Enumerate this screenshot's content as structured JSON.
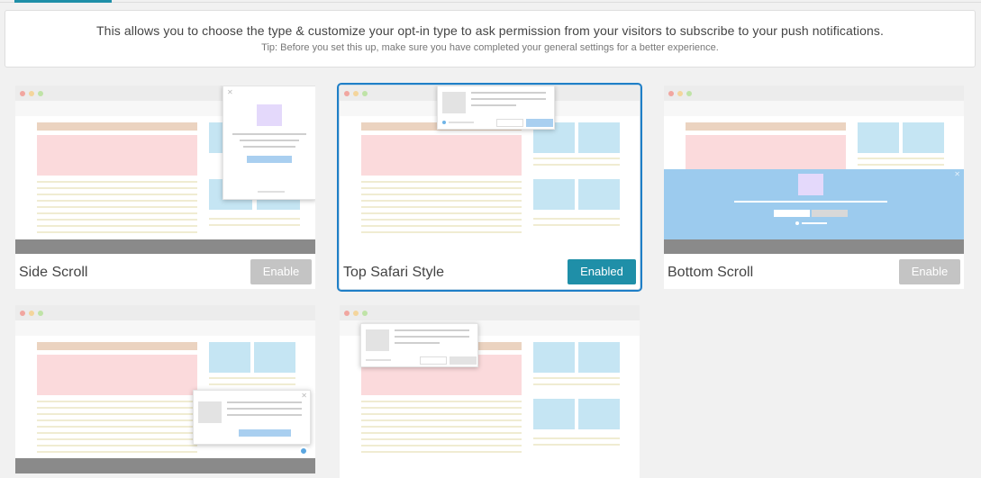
{
  "info": {
    "main": "This allows you to choose the type & customize your opt-in type to ask permission from your visitors to subscribe to your push notifications.",
    "tip": "Tip: Before you set this up, make sure you have completed your general settings for a better experience."
  },
  "cards": [
    {
      "title": "Side Scroll",
      "button": "Enable",
      "state": "disabled"
    },
    {
      "title": "Top Safari Style",
      "button": "Enabled",
      "state": "enabled"
    },
    {
      "title": "Bottom Scroll",
      "button": "Enable",
      "state": "disabled"
    },
    {
      "title": "",
      "button": "",
      "state": "disabled"
    },
    {
      "title": "",
      "button": "",
      "state": "disabled"
    }
  ],
  "colors": {
    "accent": "#1f8fa8",
    "selected_outline": "#1f7fc7",
    "disabled_button": "#c4c4c4",
    "banner_blue": "#9ccbee"
  },
  "icons": {
    "close": "close-icon",
    "bell": "bell-icon"
  }
}
